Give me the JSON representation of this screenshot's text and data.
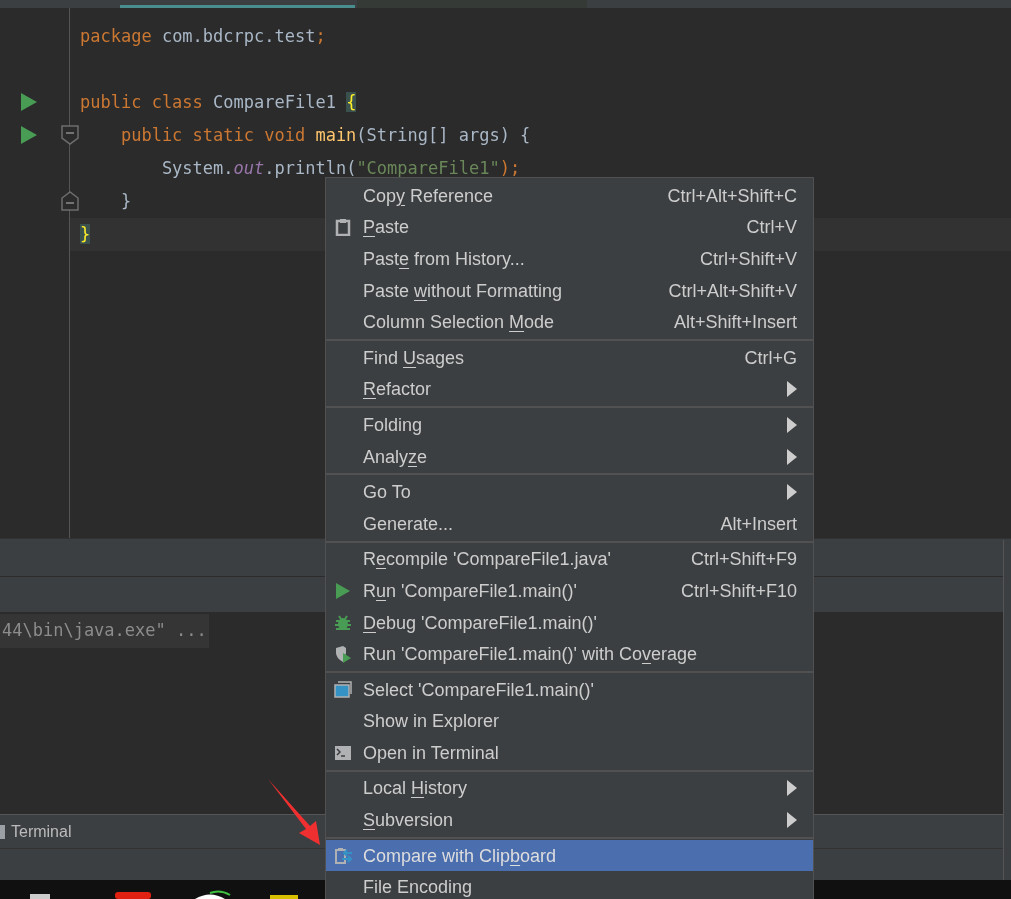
{
  "code_lines": [
    {
      "kind": "code",
      "tokens": [
        {
          "text": "package ",
          "kind": "keyword"
        },
        {
          "text": "com.bdcrpc.test",
          "kind": "plain"
        },
        {
          "text": ";",
          "kind": "keyword"
        }
      ]
    },
    {
      "kind": "blank"
    },
    {
      "kind": "code",
      "tokens": [
        {
          "text": "public class ",
          "kind": "keyword"
        },
        {
          "text": "CompareFile1 ",
          "kind": "plain"
        },
        {
          "text": "{",
          "kind": "brace"
        }
      ]
    },
    {
      "kind": "code",
      "tokens": [
        {
          "text": "    public static void ",
          "kind": "keyword"
        },
        {
          "text": "main",
          "kind": "function"
        },
        {
          "text": "(String[] args) {",
          "kind": "plain"
        }
      ]
    },
    {
      "kind": "code",
      "tokens": [
        {
          "text": "        System.",
          "kind": "plain"
        },
        {
          "text": "out",
          "kind": "field"
        },
        {
          "text": ".println(",
          "kind": "plain"
        },
        {
          "text": "\"CompareFile1\"",
          "kind": "string"
        },
        {
          "text": ");",
          "kind": "keyword"
        }
      ]
    },
    {
      "kind": "code",
      "tokens": [
        {
          "text": "    }",
          "kind": "plain"
        }
      ]
    },
    {
      "kind": "code",
      "current": true,
      "tokens": [
        {
          "text": "}",
          "kind": "brace"
        }
      ]
    },
    {
      "kind": "blank"
    }
  ],
  "console_line": "44\\bin\\java.exe\" ...",
  "tool_window_tab": "Terminal",
  "context_menu": {
    "groups": [
      [
        {
          "kind": "plain",
          "label": [
            {
              "text": "Cop"
            },
            {
              "text": "y",
              "kind": "mnemonic"
            },
            {
              "text": " Reference"
            }
          ],
          "shortcut": "Ctrl+Alt+Shift+C",
          "submenu": false,
          "selected": false
        },
        {
          "kind": "clipboard",
          "label": [
            {
              "text": "P",
              "kind": "mnemonic"
            },
            {
              "text": "aste"
            }
          ],
          "shortcut": "Ctrl+V",
          "submenu": false,
          "selected": false
        },
        {
          "kind": "plain",
          "label": [
            {
              "text": "Past"
            },
            {
              "text": "e",
              "kind": "mnemonic"
            },
            {
              "text": " from History..."
            }
          ],
          "shortcut": "Ctrl+Shift+V",
          "submenu": false,
          "selected": false
        },
        {
          "kind": "plain",
          "label": [
            {
              "text": "Paste "
            },
            {
              "text": "w",
              "kind": "mnemonic"
            },
            {
              "text": "ithout Formatting"
            }
          ],
          "shortcut": "Ctrl+Alt+Shift+V",
          "submenu": false,
          "selected": false
        },
        {
          "kind": "plain",
          "label": [
            {
              "text": "Column Selection "
            },
            {
              "text": "M",
              "kind": "mnemonic"
            },
            {
              "text": "ode"
            }
          ],
          "shortcut": "Alt+Shift+Insert",
          "submenu": false,
          "selected": false
        }
      ],
      [
        {
          "kind": "plain",
          "label": [
            {
              "text": "Find "
            },
            {
              "text": "U",
              "kind": "mnemonic"
            },
            {
              "text": "sages"
            }
          ],
          "shortcut": "Ctrl+G",
          "submenu": false,
          "selected": false
        },
        {
          "kind": "plain",
          "label": [
            {
              "text": "R",
              "kind": "mnemonic"
            },
            {
              "text": "efactor"
            }
          ],
          "submenu": true,
          "selected": false
        }
      ],
      [
        {
          "kind": "plain",
          "label": [
            {
              "text": "Folding"
            }
          ],
          "submenu": true,
          "selected": false
        },
        {
          "kind": "plain",
          "label": [
            {
              "text": "Analy"
            },
            {
              "text": "z",
              "kind": "mnemonic"
            },
            {
              "text": "e"
            }
          ],
          "submenu": true,
          "selected": false
        }
      ],
      [
        {
          "kind": "plain",
          "label": [
            {
              "text": "Go To"
            }
          ],
          "submenu": true,
          "selected": false
        },
        {
          "kind": "plain",
          "label": [
            {
              "text": "Generate..."
            }
          ],
          "shortcut": "Alt+Insert",
          "submenu": false,
          "selected": false
        }
      ],
      [
        {
          "kind": "plain",
          "label": [
            {
              "text": "R"
            },
            {
              "text": "e",
              "kind": "mnemonic"
            },
            {
              "text": "compile 'CompareFile1.java'"
            }
          ],
          "shortcut": "Ctrl+Shift+F9",
          "submenu": false,
          "selected": false
        },
        {
          "kind": "run",
          "label": [
            {
              "text": "R"
            },
            {
              "text": "u",
              "kind": "mnemonic"
            },
            {
              "text": "n 'CompareFile1.main()'"
            }
          ],
          "shortcut": "Ctrl+Shift+F10",
          "submenu": false,
          "selected": false
        },
        {
          "kind": "debug",
          "label": [
            {
              "text": "D",
              "kind": "mnemonic"
            },
            {
              "text": "ebug 'CompareFile1.main()'"
            }
          ],
          "submenu": false,
          "selected": false
        },
        {
          "kind": "coverage",
          "label": [
            {
              "text": "Run 'CompareFile1.main()' with Co"
            },
            {
              "text": "v",
              "kind": "mnemonic"
            },
            {
              "text": "erage"
            }
          ],
          "submenu": false,
          "selected": false
        }
      ],
      [
        {
          "kind": "select",
          "label": [
            {
              "text": "Select 'CompareFile1.main()'"
            }
          ],
          "submenu": false,
          "selected": false
        },
        {
          "kind": "plain",
          "label": [
            {
              "text": "Show in Explorer"
            }
          ],
          "submenu": false,
          "selected": false
        },
        {
          "kind": "terminal",
          "label": [
            {
              "text": "Open in Terminal"
            }
          ],
          "submenu": false,
          "selected": false
        }
      ],
      [
        {
          "kind": "plain",
          "label": [
            {
              "text": "Local "
            },
            {
              "text": "H",
              "kind": "mnemonic"
            },
            {
              "text": "istory"
            }
          ],
          "submenu": true,
          "selected": false
        },
        {
          "kind": "plain",
          "label": [
            {
              "text": "S",
              "kind": "mnemonic"
            },
            {
              "text": "ubversion"
            }
          ],
          "submenu": true,
          "selected": false
        }
      ],
      [
        {
          "kind": "compare",
          "label": [
            {
              "text": "Compare with Clip"
            },
            {
              "text": "b",
              "kind": "mnemonic"
            },
            {
              "text": "oard"
            }
          ],
          "submenu": false,
          "selected": true
        },
        {
          "kind": "plain",
          "label": [
            {
              "text": "File Encoding"
            }
          ],
          "submenu": false,
          "selected": false
        }
      ]
    ]
  }
}
